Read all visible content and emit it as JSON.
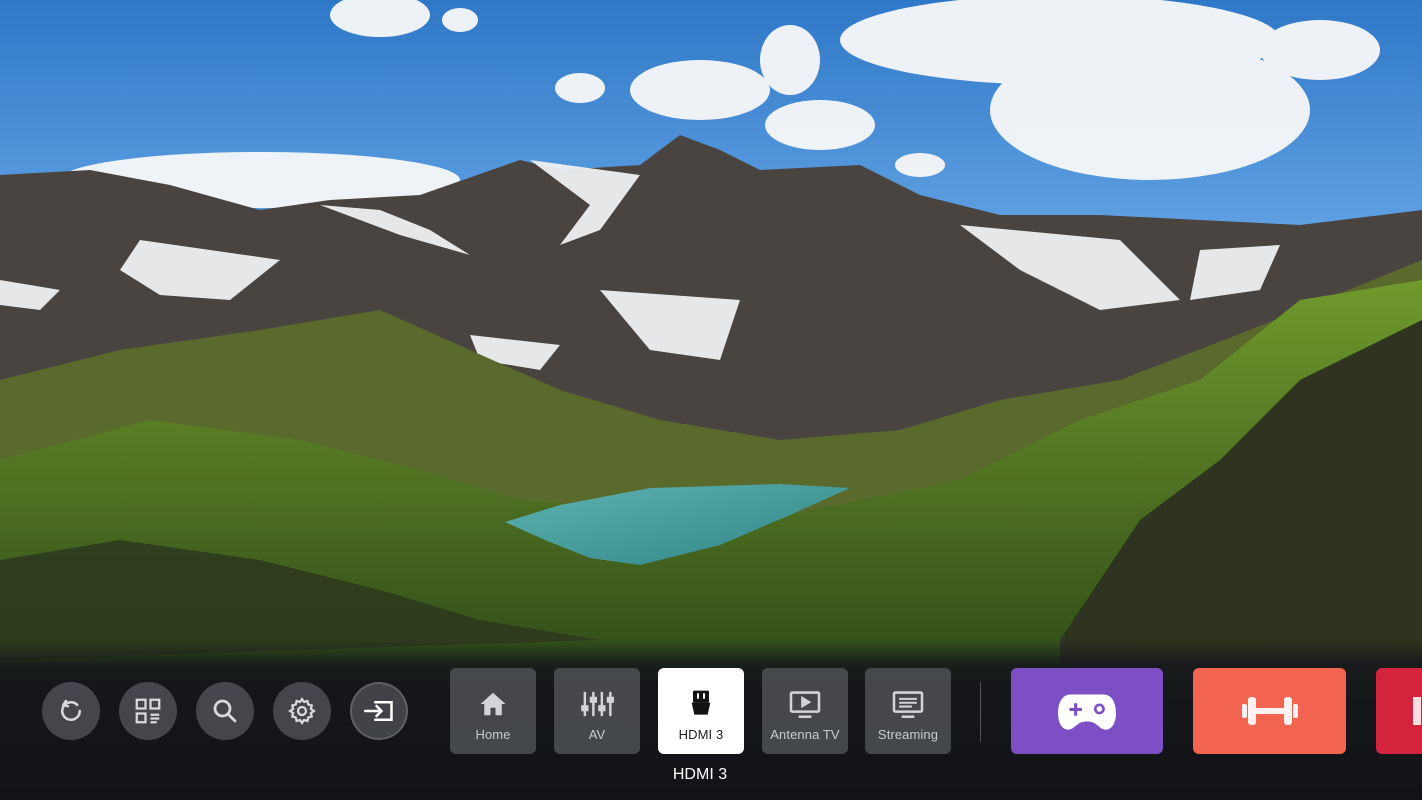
{
  "quick_actions": [
    {
      "icon": "refresh-icon"
    },
    {
      "icon": "apps-grid-icon"
    },
    {
      "icon": "search-icon"
    },
    {
      "icon": "gear-icon"
    },
    {
      "icon": "input-source-icon"
    }
  ],
  "inputs": [
    {
      "label": "Home",
      "icon": "home-icon",
      "selected": false
    },
    {
      "label": "AV",
      "icon": "av-sliders-icon",
      "selected": false
    },
    {
      "label": "HDMI 3",
      "icon": "hdmi-icon",
      "selected": true
    },
    {
      "label": "Antenna TV",
      "icon": "tv-icon",
      "selected": false
    },
    {
      "label": "Streaming",
      "icon": "streaming-icon",
      "selected": false
    }
  ],
  "selected_caption": "HDMI 3",
  "apps": [
    {
      "icon": "gamepad-icon",
      "color": "#7d4fc4"
    },
    {
      "icon": "dumbbell-icon",
      "color": "#f2644f"
    },
    {
      "icon": "app-partial-icon",
      "color": "#d4233d"
    }
  ],
  "colors": {
    "selected_tile": "#ffffff",
    "tile": "#5a5c62",
    "bar": "#16181c"
  }
}
